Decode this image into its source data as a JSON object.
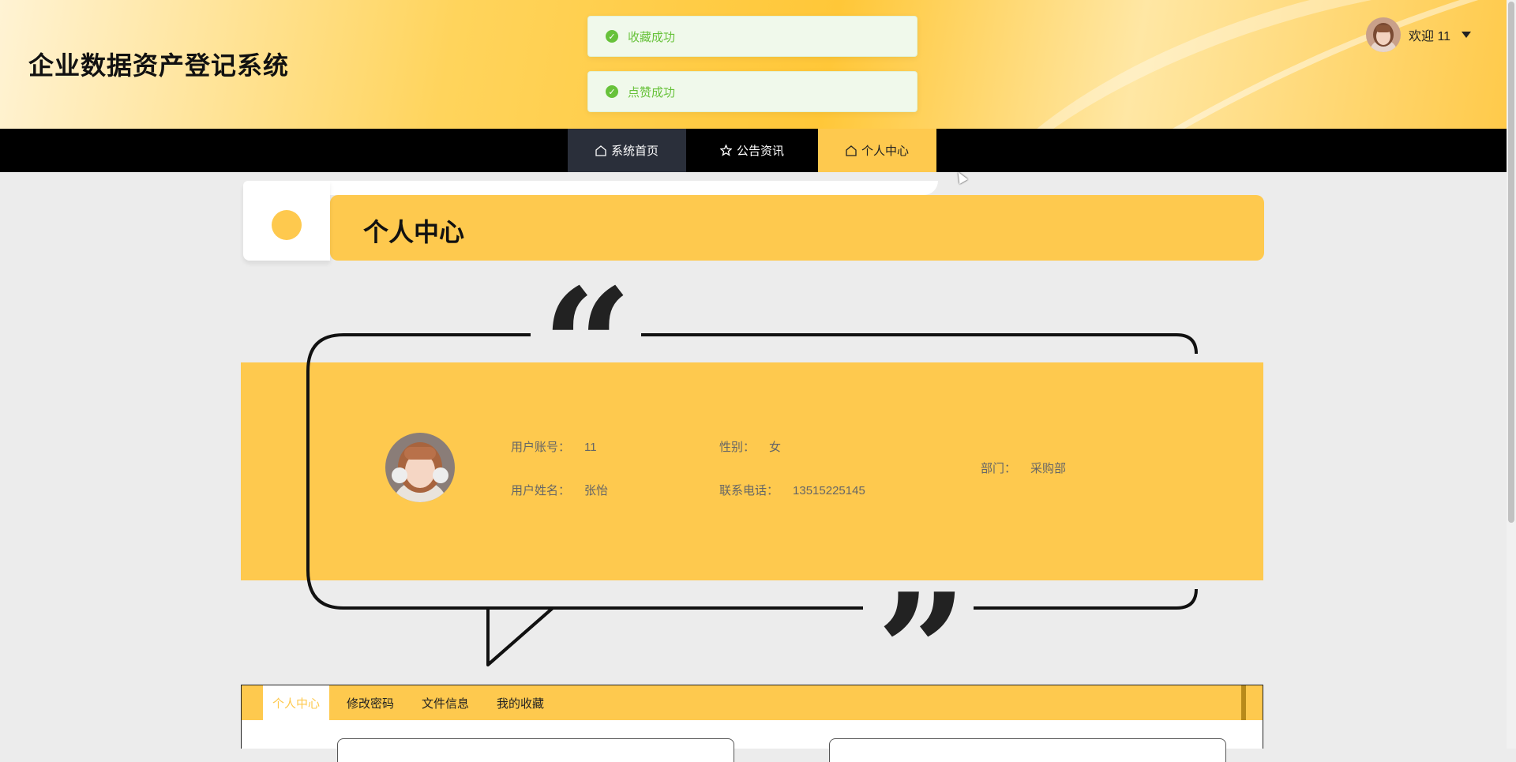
{
  "header": {
    "site_title": "企业数据资产登记系统",
    "welcome_text": "欢迎 11",
    "colors": {
      "accent": "#fec94e",
      "nav_bg": "#000000",
      "success": "#67c23a"
    }
  },
  "toasts": [
    {
      "text": "收藏成功",
      "icon": "check-circle-icon"
    },
    {
      "text": "点赞成功",
      "icon": "check-circle-icon"
    }
  ],
  "nav": {
    "items": [
      {
        "label": "系统首页",
        "icon": "home-icon"
      },
      {
        "label": "公告资讯",
        "icon": "star-icon"
      },
      {
        "label": "个人中心",
        "icon": "home-icon"
      }
    ],
    "active_index": 2
  },
  "page": {
    "title": "个人中心"
  },
  "profile": {
    "account_label": "用户账号：",
    "account_value": "11",
    "name_label": "用户姓名：",
    "name_value": "张怡",
    "gender_label": "性别：",
    "gender_value": "女",
    "phone_label": "联系电话：",
    "phone_value": "13515225145",
    "dept_label": "部门：",
    "dept_value": "采购部"
  },
  "tabs": {
    "items": [
      "个人中心",
      "修改密码",
      "文件信息",
      "我的收藏"
    ],
    "active_index": 0
  }
}
